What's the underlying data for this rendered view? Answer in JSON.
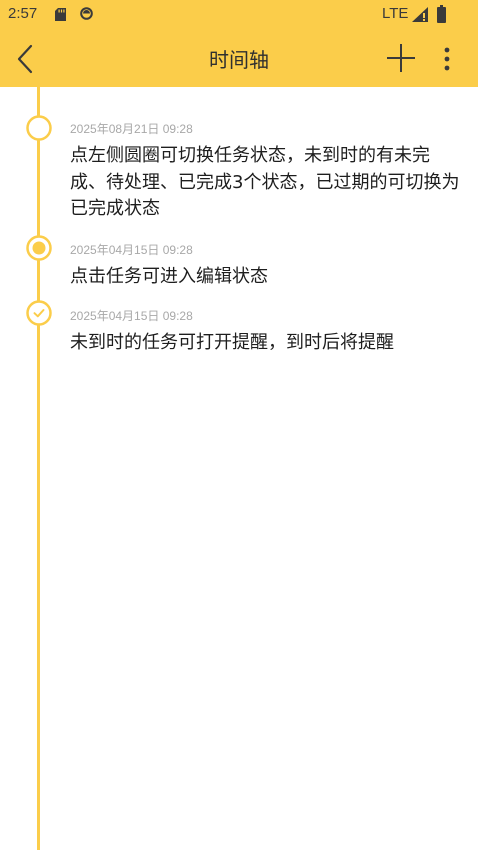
{
  "status_bar": {
    "time": "2:57",
    "network": "LTE",
    "icons": [
      "sd-card-icon",
      "sync-icon",
      "signal-icon",
      "battery-icon"
    ]
  },
  "app_bar": {
    "title": "时间轴",
    "back_icon": "chevron-left-icon",
    "add_icon": "plus-icon",
    "more_icon": "more-vertical-icon"
  },
  "colors": {
    "accent": "#fbcd4a",
    "title_text": "#2f2f2f",
    "date_text": "#a8a8a8",
    "body_text": "#1e1e1e"
  },
  "tasks": [
    {
      "date": "2025年08月21日 09:28",
      "text": "点左侧圆圈可切换任务状态，未到时的有未完成、待处理、已完成3个状态，已过期的可切换为已完成状态",
      "state": "not-started",
      "marker_icon": "empty-circle-icon"
    },
    {
      "date": "2025年04月15日 09:28",
      "text": "点击任务可进入编辑状态",
      "state": "pending",
      "marker_icon": "filled-dot-circle-icon"
    },
    {
      "date": "2025年04月15日 09:28",
      "text": "未到时的任务可打开提醒，到时后将提醒",
      "state": "completed",
      "marker_icon": "check-circle-icon"
    }
  ]
}
